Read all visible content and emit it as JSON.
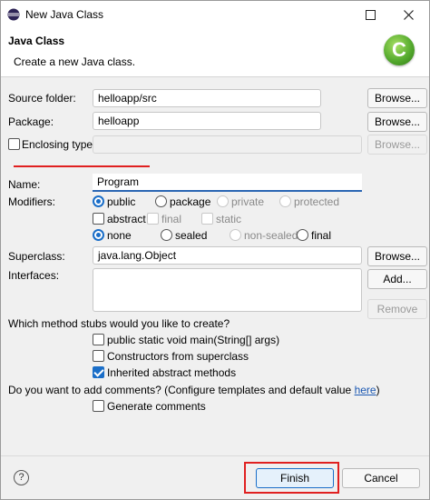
{
  "window": {
    "title": "New Java Class"
  },
  "header": {
    "title": "Java Class",
    "subtitle": "Create a new Java class.",
    "logo_letter": "C"
  },
  "source_folder": {
    "label": "Source folder:",
    "value": "helloapp/src",
    "browse": "Browse..."
  },
  "package": {
    "label": "Package:",
    "value": "helloapp",
    "browse": "Browse..."
  },
  "enclosing_type": {
    "label": "Enclosing type:",
    "value": "",
    "browse": "Browse..."
  },
  "name": {
    "label": "Name:",
    "value": "Program"
  },
  "modifiers": {
    "label": "Modifiers:",
    "access": [
      "public",
      "package",
      "private",
      "protected"
    ],
    "selected_access": "public",
    "flags": [
      "abstract",
      "final",
      "static"
    ],
    "inheritance": [
      "none",
      "sealed",
      "non-sealed",
      "final"
    ],
    "selected_inheritance": "none"
  },
  "superclass": {
    "label": "Superclass:",
    "value": "java.lang.Object",
    "browse": "Browse..."
  },
  "interfaces": {
    "label": "Interfaces:",
    "add": "Add...",
    "remove": "Remove"
  },
  "stubs": {
    "question": "Which method stubs would you like to create?",
    "options": [
      {
        "label": "public static void main(String[] args)",
        "checked": false
      },
      {
        "label": "Constructors from superclass",
        "checked": false
      },
      {
        "label": "Inherited abstract methods",
        "checked": true
      }
    ]
  },
  "comments": {
    "question": "Do you want to add comments? (Configure templates and default value ",
    "link": "here",
    "question_end": ")",
    "generate": "Generate comments"
  },
  "buttons": {
    "help": "?",
    "finish": "Finish",
    "cancel": "Cancel"
  },
  "colors": {
    "accent": "#1a6ec8",
    "highlight": "#e02020",
    "logo": "#56ab2f"
  }
}
